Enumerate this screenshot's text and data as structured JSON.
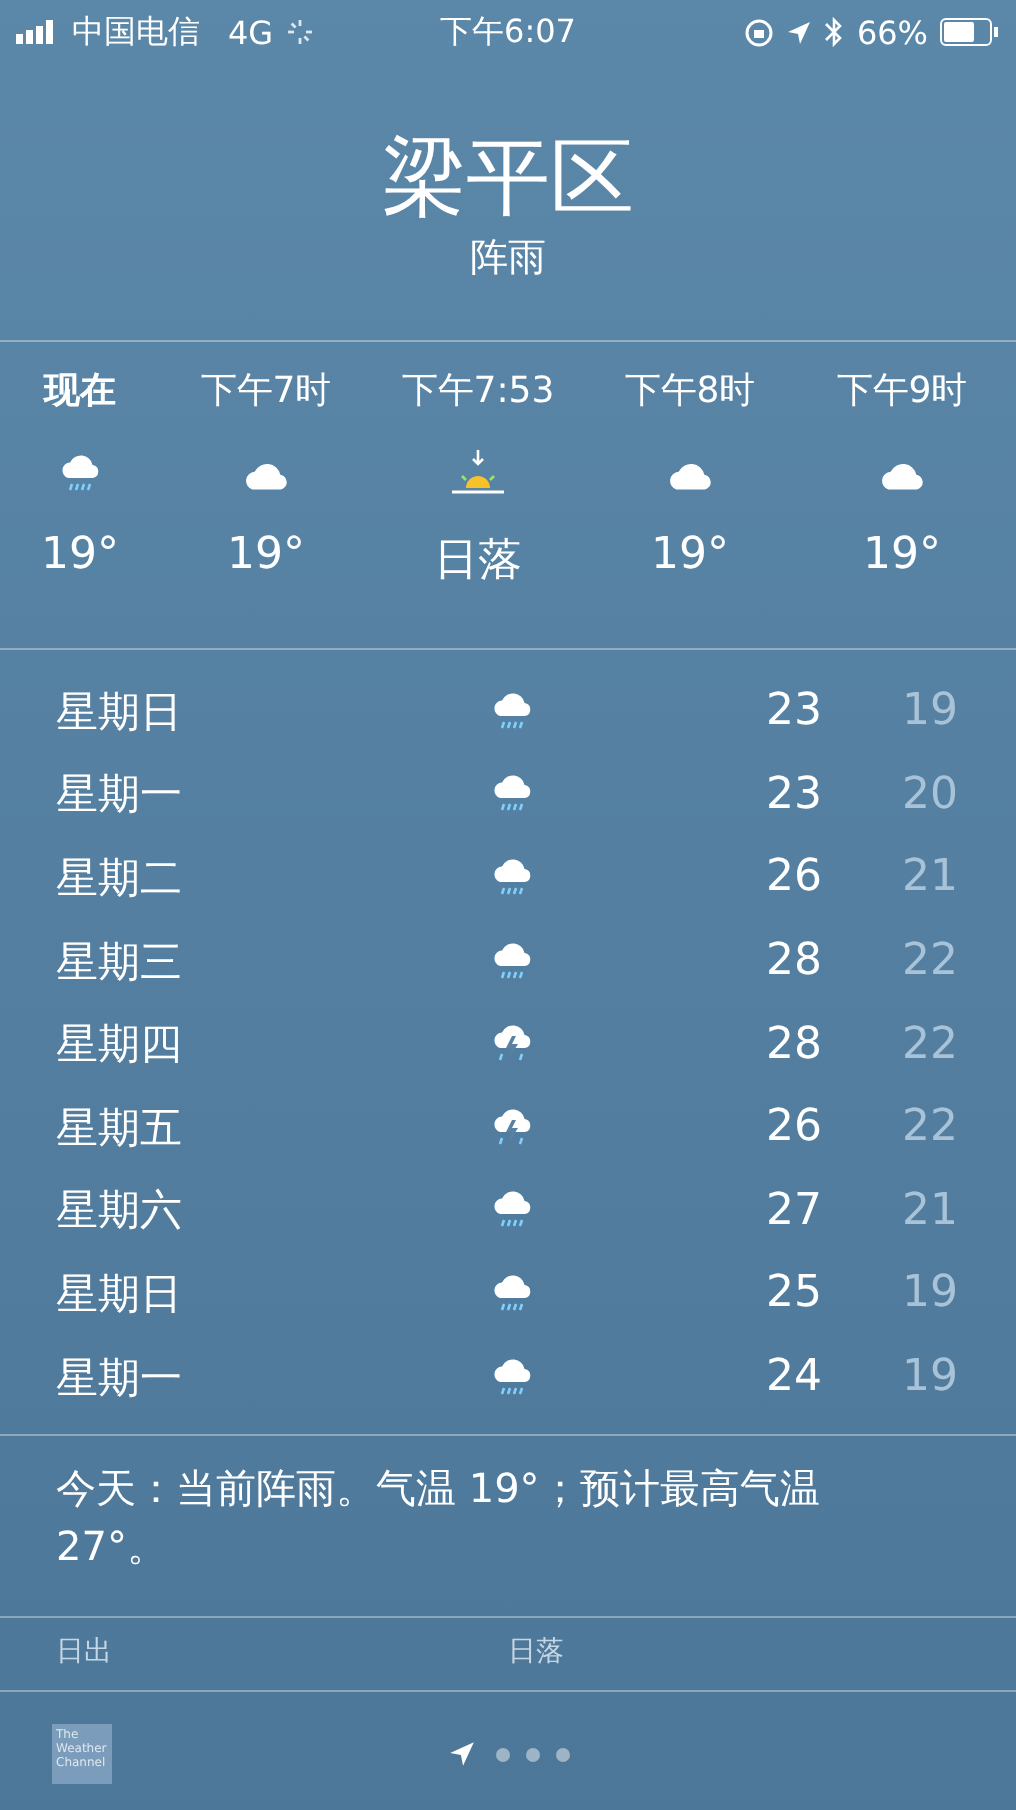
{
  "status_bar": {
    "carrier": "中国电信",
    "network": "4G",
    "time": "下午6:07",
    "battery": "66%"
  },
  "location": {
    "city": "梁平区",
    "condition": "阵雨"
  },
  "hourly": [
    {
      "time": "现在",
      "kind": "rain",
      "temp": "19°",
      "selected": true
    },
    {
      "time": "下午7时",
      "kind": "cloud",
      "temp": "19°",
      "selected": false
    },
    {
      "time": "下午7:53",
      "kind": "sunset",
      "temp": "日落",
      "selected": false
    },
    {
      "time": "下午8时",
      "kind": "cloud",
      "temp": "19°",
      "selected": false
    },
    {
      "time": "下午9时",
      "kind": "cloud",
      "temp": "19°",
      "selected": false
    }
  ],
  "daily": [
    {
      "day": "星期日",
      "kind": "rain",
      "high": "23",
      "low": "19"
    },
    {
      "day": "星期一",
      "kind": "rain",
      "high": "23",
      "low": "20"
    },
    {
      "day": "星期二",
      "kind": "rain",
      "high": "26",
      "low": "21"
    },
    {
      "day": "星期三",
      "kind": "rain",
      "high": "28",
      "low": "22"
    },
    {
      "day": "星期四",
      "kind": "storm",
      "high": "28",
      "low": "22"
    },
    {
      "day": "星期五",
      "kind": "storm",
      "high": "26",
      "low": "22"
    },
    {
      "day": "星期六",
      "kind": "rain",
      "high": "27",
      "low": "21"
    },
    {
      "day": "星期日",
      "kind": "rain",
      "high": "25",
      "low": "19"
    },
    {
      "day": "星期一",
      "kind": "rain",
      "high": "24",
      "low": "19"
    }
  ],
  "summary": "今天：当前阵雨。气温 19°；预计最高气温 27°。",
  "details": [
    {
      "label": "日出"
    },
    {
      "label": "日落"
    }
  ],
  "footer": {
    "logo_text": "The Weather Channel",
    "pages": [
      {
        "kind": "location",
        "selected": true
      },
      {
        "kind": "dot",
        "selected": false
      },
      {
        "kind": "dot",
        "selected": false
      },
      {
        "kind": "dot",
        "selected": false
      }
    ]
  }
}
